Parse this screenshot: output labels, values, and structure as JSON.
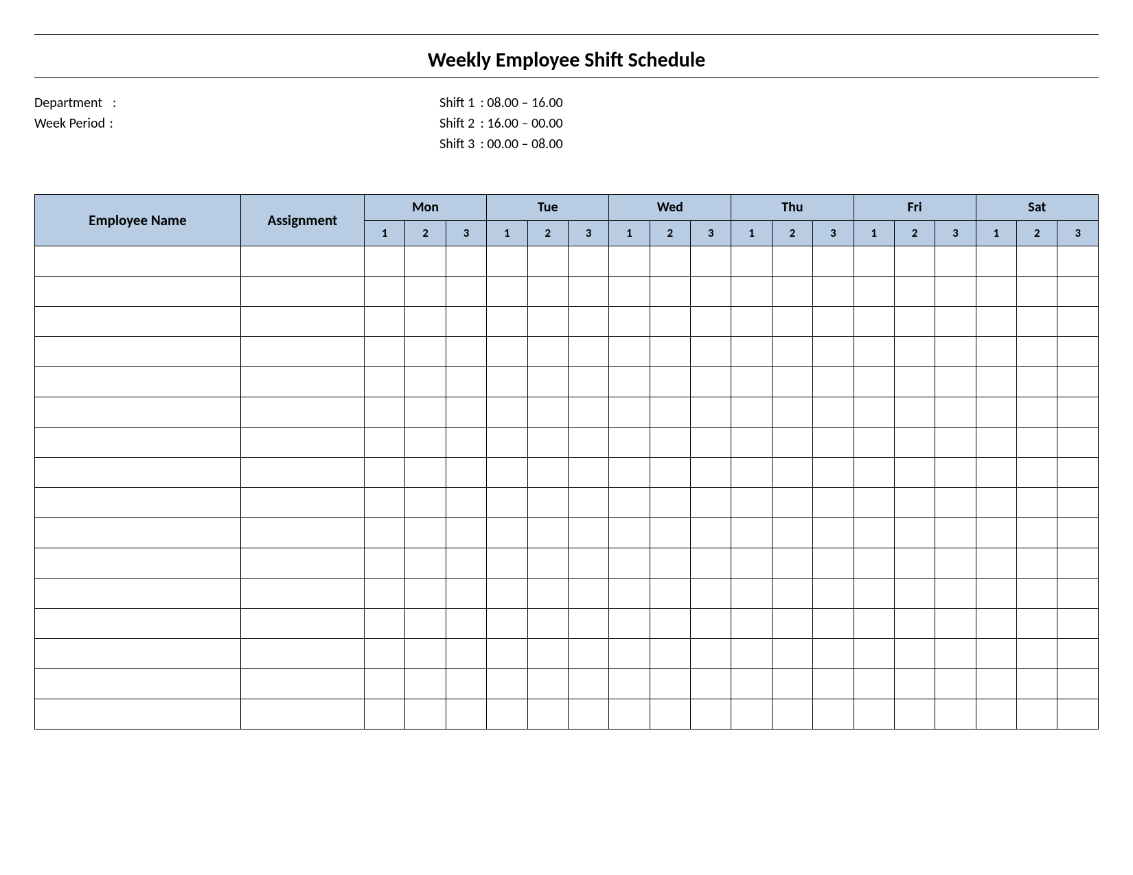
{
  "title": "Weekly Employee Shift Schedule",
  "meta": {
    "departmentLabel": "Department",
    "weekPeriodLabel": "Week  Period",
    "departmentValue": "",
    "weekPeriodValue": ""
  },
  "shifts": [
    {
      "label": "Shift 1",
      "time": "08.00  – 16.00"
    },
    {
      "label": "Shift 2",
      "time": "16.00  – 00.00"
    },
    {
      "label": "Shift 3",
      "time": "00.00  – 08.00"
    }
  ],
  "table": {
    "headers": {
      "employee": "Employee Name",
      "assignment": "Assignment",
      "days": [
        "Mon",
        "Tue",
        "Wed",
        "Thu",
        "Fri",
        "Sat"
      ],
      "shiftNumbers": [
        "1",
        "2",
        "3"
      ]
    },
    "rowCount": 16
  }
}
